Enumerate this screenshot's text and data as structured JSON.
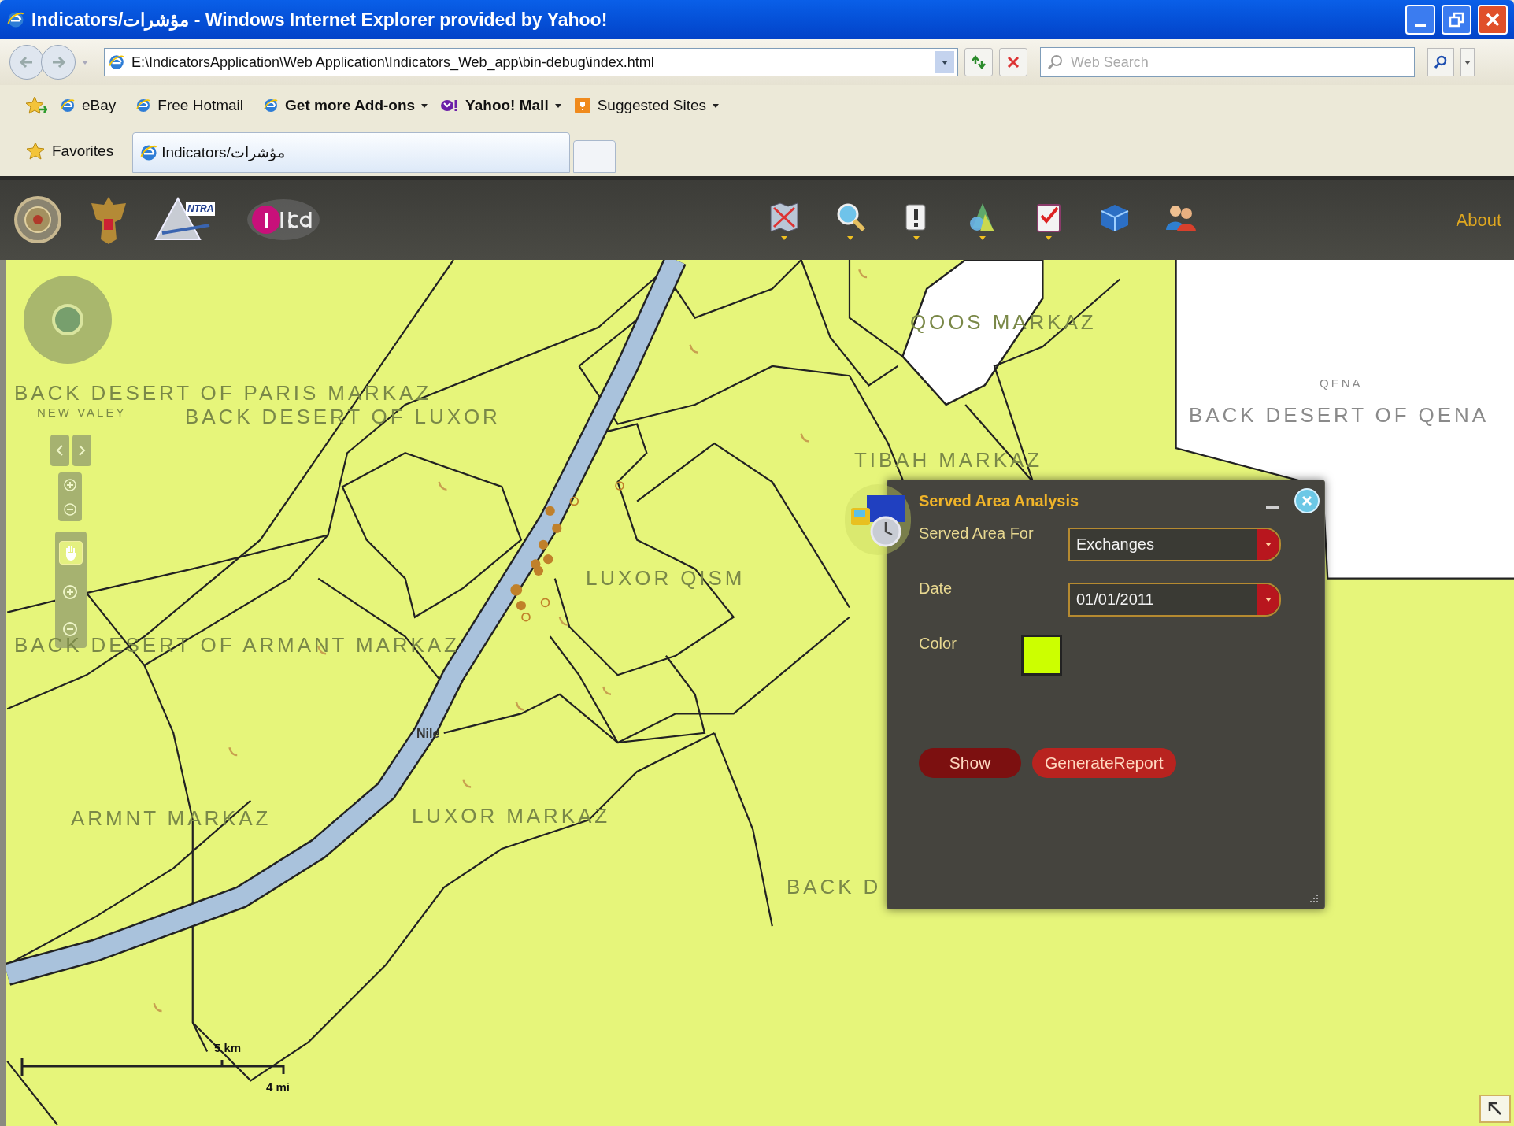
{
  "window": {
    "title": "Indicators/مؤشرات - Windows Internet Explorer provided by Yahoo!"
  },
  "address_bar": {
    "url": "E:\\IndicatorsApplication\\Web Application\\Indicators_Web_app\\bin-debug\\index.html"
  },
  "search": {
    "placeholder": "Web Search"
  },
  "favorites_bar": [
    {
      "label": "eBay",
      "kind": "page",
      "menu": false
    },
    {
      "label": "Free Hotmail",
      "kind": "page",
      "menu": false
    },
    {
      "label": "Get more Add-ons",
      "kind": "addon",
      "menu": true
    },
    {
      "label": "Yahoo! Mail",
      "kind": "yahoo",
      "menu": true
    },
    {
      "label": "Suggested Sites",
      "kind": "suggested",
      "menu": true
    }
  ],
  "tab_row": {
    "favorites": "Favorites",
    "tabs": [
      {
        "label": "Indicators/مؤشرات",
        "selected": true
      }
    ]
  },
  "app_toolbar": {
    "logos": [
      {
        "kind": "emblem"
      },
      {
        "kind": "eagle"
      },
      {
        "kind": "ntra",
        "text": "NTRA"
      },
      {
        "kind": "itida"
      }
    ],
    "tools": [
      {
        "kind": "map",
        "menu": true
      },
      {
        "kind": "search",
        "menu": true
      },
      {
        "kind": "alert",
        "menu": true
      },
      {
        "kind": "layers",
        "menu": true
      },
      {
        "kind": "checklist",
        "menu": true
      },
      {
        "kind": "cube",
        "menu": false
      },
      {
        "kind": "users",
        "menu": false
      }
    ],
    "about": "About"
  },
  "map": {
    "labels": [
      {
        "text": "QOOS MARKAZ",
        "kind": "region"
      },
      {
        "text": "QENA",
        "kind": "small"
      },
      {
        "text": "BACK DESERT OF QENA",
        "kind": "region"
      },
      {
        "text": "BACK DESERT OF PARIS MARKAZ",
        "kind": "region"
      },
      {
        "text": "NEW VALEY",
        "kind": "small"
      },
      {
        "text": "BACK DESERT OF LUXOR",
        "kind": "region"
      },
      {
        "text": "TIBAH MARKAZ",
        "kind": "region"
      },
      {
        "text": "LUXOR QISM",
        "kind": "region"
      },
      {
        "text": "BACK DESERT OF ARMANT MARKAZ",
        "kind": "region"
      },
      {
        "text": "Nile",
        "kind": "river"
      },
      {
        "text": "ARMNT MARKAZ",
        "kind": "region"
      },
      {
        "text": "LUXOR MARKAZ",
        "kind": "region"
      },
      {
        "text": "BACK D",
        "kind": "region"
      }
    ],
    "scale": {
      "km": "5 km",
      "mi": "4 mi"
    }
  },
  "panel": {
    "title": "Served Area Analysis",
    "fields": [
      {
        "label": "Served Area For",
        "kind": "dropdown",
        "value": "Exchanges"
      },
      {
        "label": "Date",
        "kind": "date",
        "value": "01/01/2011"
      },
      {
        "label": "Color",
        "kind": "color",
        "color": "#ccff00"
      }
    ],
    "buttons": [
      "Show",
      "GenerateReport"
    ]
  }
}
